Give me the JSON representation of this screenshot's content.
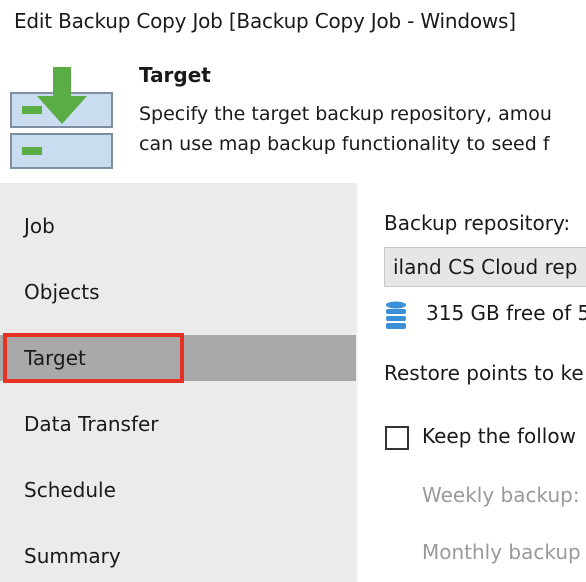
{
  "window": {
    "title": "Edit Backup Copy Job [Backup Copy Job - Windows]"
  },
  "header": {
    "title": "Target",
    "description_line1": "Specify the target backup repository, amou",
    "description_line2": "can use map backup functionality to seed f",
    "icon": "backup-repository-target-icon"
  },
  "sidebar": {
    "items": [
      {
        "label": "Job",
        "active": false
      },
      {
        "label": "Objects",
        "active": false
      },
      {
        "label": "Target",
        "active": true
      },
      {
        "label": "Data Transfer",
        "active": false
      },
      {
        "label": "Schedule",
        "active": false
      },
      {
        "label": "Summary",
        "active": false
      }
    ]
  },
  "main": {
    "repository_label": "Backup repository:",
    "repository_value": "iland CS Cloud rep",
    "free_space": "315 GB free of 5",
    "restore_points_label": "Restore points to ke",
    "keep_checkbox_label": "Keep the follow",
    "keep_checkbox_checked": false,
    "weekly_label": "Weekly backup:",
    "monthly_label": "Monthly backup"
  },
  "colors": {
    "sidebar_bg": "#ebebeb",
    "active_item_bg": "#a9a9a9",
    "highlight": "#e53224",
    "icon_green": "#5aac45",
    "icon_blue": "#3b8fd9"
  }
}
